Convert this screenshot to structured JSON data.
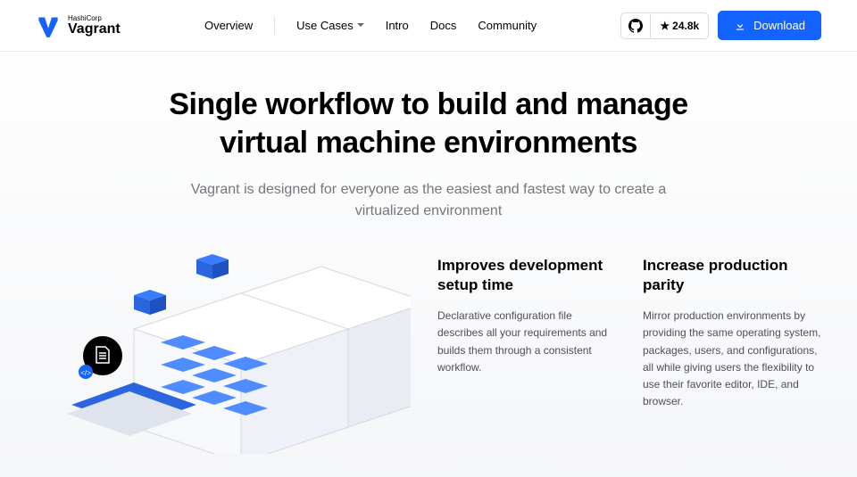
{
  "brand": {
    "company": "HashiCorp",
    "product": "Vagrant"
  },
  "nav": {
    "overview": "Overview",
    "usecases": "Use Cases",
    "intro": "Intro",
    "docs": "Docs",
    "community": "Community"
  },
  "github": {
    "stars": "24.8k"
  },
  "download": {
    "label": "Download"
  },
  "hero": {
    "title": "Single workflow to build and manage virtual machine environments",
    "subtitle": "Vagrant is designed for everyone as the easiest and fastest way to create a virtualized environment"
  },
  "features": {
    "f1": {
      "title": "Improves development setup time",
      "body": "Declarative configuration file describes all your requirements and builds them through a consistent workflow."
    },
    "f2": {
      "title": "Increase production parity",
      "body": "Mirror production environments by providing the same operating system, packages, users, and configurations, all while giving users the flexibility to use their favorite editor, IDE, and browser."
    }
  }
}
